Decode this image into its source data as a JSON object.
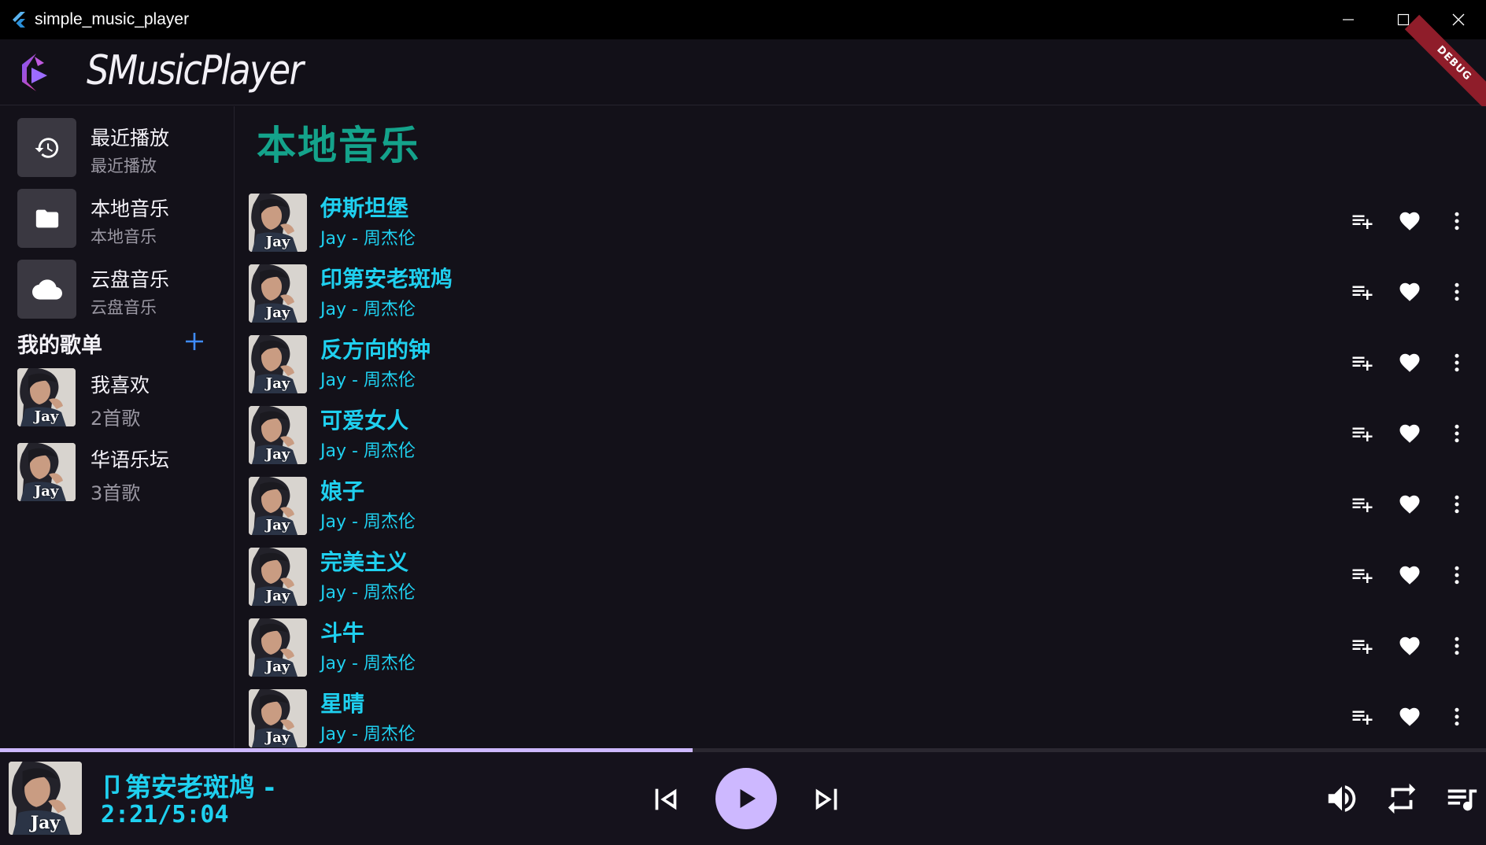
{
  "window": {
    "title": "simple_music_player"
  },
  "header": {
    "brand": "SMusicPlayer",
    "debug_label": "DEBUG"
  },
  "sidebar": {
    "nav": [
      {
        "title": "最近播放",
        "subtitle": "最近播放",
        "icon": "history-icon"
      },
      {
        "title": "本地音乐",
        "subtitle": "本地音乐",
        "icon": "folder-icon"
      },
      {
        "title": "云盘音乐",
        "subtitle": "云盘音乐",
        "icon": "cloud-icon"
      }
    ],
    "playlists_heading": "我的歌单",
    "playlists": [
      {
        "name": "我喜欢",
        "count": "2首歌"
      },
      {
        "name": "华语乐坛",
        "count": "3首歌"
      }
    ]
  },
  "main": {
    "title": "本地音乐",
    "songs": [
      {
        "title": "伊斯坦堡",
        "artist": "Jay - 周杰伦"
      },
      {
        "title": "印第安老斑鸠",
        "artist": "Jay - 周杰伦"
      },
      {
        "title": "反方向的钟",
        "artist": "Jay - 周杰伦"
      },
      {
        "title": "可爱女人",
        "artist": "Jay - 周杰伦"
      },
      {
        "title": "娘子",
        "artist": "Jay - 周杰伦"
      },
      {
        "title": "完美主义",
        "artist": "Jay - 周杰伦"
      },
      {
        "title": "斗牛",
        "artist": "Jay - 周杰伦"
      },
      {
        "title": "星晴",
        "artist": "Jay - 周杰伦"
      }
    ]
  },
  "cover_text": "Jay",
  "player": {
    "now_playing": "卩第安老斑鸠 -",
    "time": "2:21/5:04",
    "progress": 0.466
  },
  "colors": {
    "accent_cyan": "#1fd0ef",
    "accent_teal": "#14a38b",
    "play_button": "#cdb8ff",
    "background": "#131119"
  }
}
